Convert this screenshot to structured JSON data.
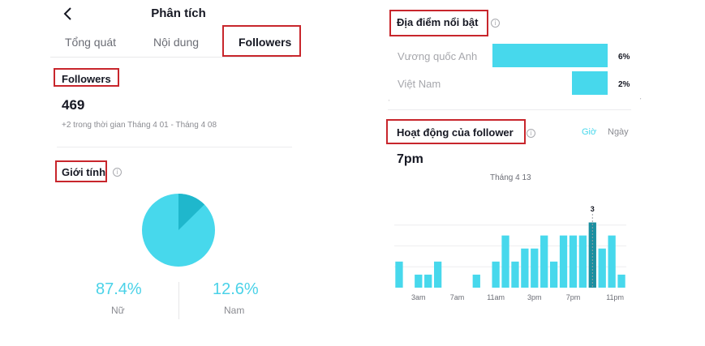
{
  "header": {
    "title": "Phân tích"
  },
  "tabs": [
    {
      "label": "Tổng quát"
    },
    {
      "label": "Nội dung"
    },
    {
      "label": "Followers",
      "active": true
    }
  ],
  "followers": {
    "heading": "Followers",
    "count": "469",
    "change": "+2 trong thời gian Tháng 4 01 - Tháng 4 08"
  },
  "gender": {
    "heading": "Giới tính",
    "female": {
      "label": "Nữ",
      "percent": "87.4%",
      "value": 87.4
    },
    "male": {
      "label": "Nam",
      "percent": "12.6%",
      "value": 12.6
    }
  },
  "locations": {
    "heading": "Địa điểm nổi bật",
    "items": [
      {
        "name": "Vương quốc Anh",
        "percent": "6%",
        "value": 6
      },
      {
        "name": "Việt Nam",
        "percent": "2%",
        "value": 2
      }
    ]
  },
  "activity": {
    "heading": "Hoạt động của follower",
    "toggle": {
      "hour": "Giờ",
      "day": "Ngày"
    },
    "peak_time": "7pm",
    "date": "Tháng 4 13",
    "highlight_label": "3"
  },
  "colors": {
    "accent": "#47d8ec",
    "accent_dark": "#1b8fa0",
    "annotation": "#c8262c",
    "text": "#161823",
    "muted": "#8a8b91"
  },
  "icons": {
    "back": "chevron-left-icon",
    "info": "info-icon"
  },
  "chart_data": {
    "type": "bar",
    "title": "",
    "x": [
      0,
      1,
      2,
      3,
      4,
      5,
      6,
      7,
      8,
      9,
      10,
      11,
      12,
      13,
      14,
      15,
      16,
      17,
      18,
      19,
      20,
      21,
      22,
      23
    ],
    "tick_labels": [
      "3am",
      "7am",
      "11am",
      "3pm",
      "7pm",
      "11pm"
    ],
    "values": [
      1.0,
      0,
      0.5,
      0.5,
      1.0,
      0,
      0,
      0,
      0.5,
      0,
      1.0,
      2.0,
      1.0,
      1.5,
      1.5,
      2.0,
      1.0,
      2.0,
      2.0,
      2.0,
      2.5,
      1.5,
      2.0,
      0.5
    ],
    "highlight_index": 20,
    "highlight_value": 3,
    "ylim": [
      0,
      3.2
    ],
    "grid": true
  }
}
